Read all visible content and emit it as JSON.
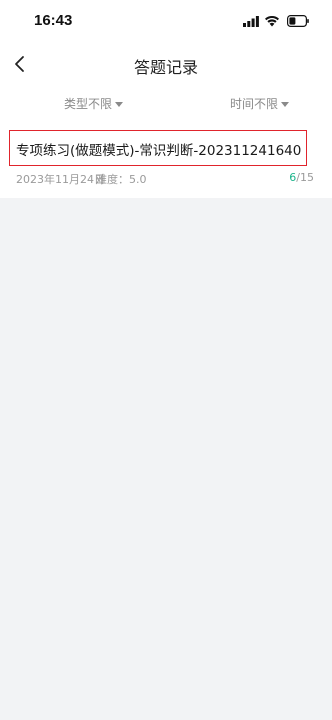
{
  "status_bar": {
    "time": "16:43"
  },
  "nav": {
    "title": "答题记录"
  },
  "filters": {
    "type_label": "类型不限",
    "time_label": "时间不限"
  },
  "records": [
    {
      "title": "专项练习(做题模式)-常识判断-202311241640",
      "date": "2023年11月24日",
      "difficulty": "难度：5.0",
      "progress_done": "6",
      "progress_total": "/15"
    }
  ],
  "colors": {
    "highlight_border": "#e0242c",
    "progress_accent": "#1bb38a",
    "content_background": "#f2f3f5"
  },
  "icons": {
    "back": "chevron-left-icon",
    "signal": "signal-icon",
    "wifi": "wifi-icon",
    "battery": "battery-icon",
    "filter_caret": "caret-down-icon"
  }
}
